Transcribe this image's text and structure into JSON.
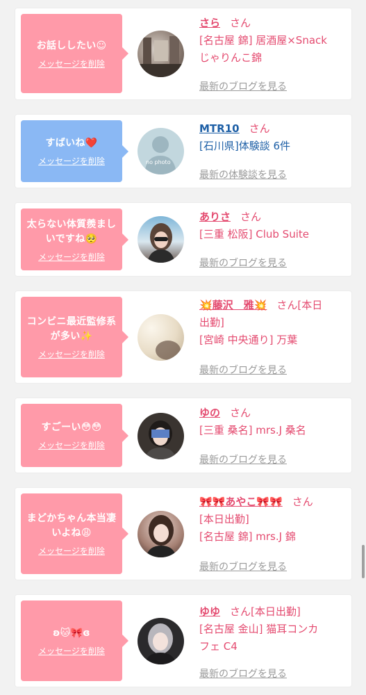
{
  "delete_label": "メッセージを削除",
  "items": [
    {
      "message": "お話ししたい☺",
      "name": "さら",
      "san": "さん",
      "lines": [
        "[名古屋 錦] 居酒屋×Snack",
        "じゃりんこ錦"
      ],
      "link": "最新のブログを見る",
      "avatar": "photo"
    },
    {
      "message": "すばいね❤️",
      "name": "MTR10",
      "san": "さん",
      "lines": [
        "[石川県]体験談 6件"
      ],
      "link": "最新の体験談を見る",
      "avatar": "no photo"
    },
    {
      "message": "太らない体質羨ましいですね🥺",
      "name": "ありさ",
      "san": "さん",
      "lines": [
        "[三重 松阪] Club Suite"
      ],
      "link": "最新のブログを見る",
      "avatar": "photo"
    },
    {
      "message": "コンビニ最近監修系が多い✨",
      "name": "💥藤沢　雅💥",
      "san": "さん[本日",
      "lines": [
        "出勤]",
        "[宮崎 中央通り] 万葉"
      ],
      "link": "最新のブログを見る",
      "avatar": "photo"
    },
    {
      "message": "すごーい😳😳",
      "name": "ゆの",
      "san": "さん",
      "lines": [
        "[三重 桑名] mrs.J 桑名"
      ],
      "link": "最新のブログを見る",
      "avatar": "photo"
    },
    {
      "message": "まどかちゃん本当凄いよね😩",
      "name": "🎀🎀あやこ🎀🎀",
      "san": "さん",
      "lines": [
        "[本日出勤]",
        "[名古屋 錦] mrs.J 錦"
      ],
      "link": "最新のブログを見る",
      "avatar": "photo"
    },
    {
      "message": "ʚ🐱🎀ɞ",
      "name": "ゆゆ",
      "san": "さん[本日出勤]",
      "lines": [
        "[名古屋 金山] 猫耳コンカ",
        "フェ C4"
      ],
      "link": "最新のブログを見る",
      "avatar": "photo"
    }
  ],
  "no_photo_text": "no photo"
}
